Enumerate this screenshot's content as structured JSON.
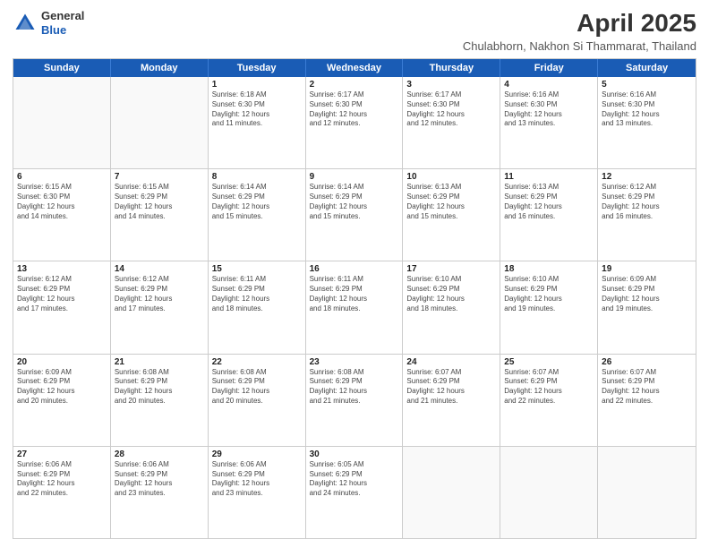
{
  "header": {
    "logo_general": "General",
    "logo_blue": "Blue",
    "month_year": "April 2025",
    "location": "Chulabhorn, Nakhon Si Thammarat, Thailand"
  },
  "weekdays": [
    "Sunday",
    "Monday",
    "Tuesday",
    "Wednesday",
    "Thursday",
    "Friday",
    "Saturday"
  ],
  "rows": [
    [
      {
        "day": "",
        "info": ""
      },
      {
        "day": "",
        "info": ""
      },
      {
        "day": "1",
        "info": "Sunrise: 6:18 AM\nSunset: 6:30 PM\nDaylight: 12 hours\nand 11 minutes."
      },
      {
        "day": "2",
        "info": "Sunrise: 6:17 AM\nSunset: 6:30 PM\nDaylight: 12 hours\nand 12 minutes."
      },
      {
        "day": "3",
        "info": "Sunrise: 6:17 AM\nSunset: 6:30 PM\nDaylight: 12 hours\nand 12 minutes."
      },
      {
        "day": "4",
        "info": "Sunrise: 6:16 AM\nSunset: 6:30 PM\nDaylight: 12 hours\nand 13 minutes."
      },
      {
        "day": "5",
        "info": "Sunrise: 6:16 AM\nSunset: 6:30 PM\nDaylight: 12 hours\nand 13 minutes."
      }
    ],
    [
      {
        "day": "6",
        "info": "Sunrise: 6:15 AM\nSunset: 6:30 PM\nDaylight: 12 hours\nand 14 minutes."
      },
      {
        "day": "7",
        "info": "Sunrise: 6:15 AM\nSunset: 6:29 PM\nDaylight: 12 hours\nand 14 minutes."
      },
      {
        "day": "8",
        "info": "Sunrise: 6:14 AM\nSunset: 6:29 PM\nDaylight: 12 hours\nand 15 minutes."
      },
      {
        "day": "9",
        "info": "Sunrise: 6:14 AM\nSunset: 6:29 PM\nDaylight: 12 hours\nand 15 minutes."
      },
      {
        "day": "10",
        "info": "Sunrise: 6:13 AM\nSunset: 6:29 PM\nDaylight: 12 hours\nand 15 minutes."
      },
      {
        "day": "11",
        "info": "Sunrise: 6:13 AM\nSunset: 6:29 PM\nDaylight: 12 hours\nand 16 minutes."
      },
      {
        "day": "12",
        "info": "Sunrise: 6:12 AM\nSunset: 6:29 PM\nDaylight: 12 hours\nand 16 minutes."
      }
    ],
    [
      {
        "day": "13",
        "info": "Sunrise: 6:12 AM\nSunset: 6:29 PM\nDaylight: 12 hours\nand 17 minutes."
      },
      {
        "day": "14",
        "info": "Sunrise: 6:12 AM\nSunset: 6:29 PM\nDaylight: 12 hours\nand 17 minutes."
      },
      {
        "day": "15",
        "info": "Sunrise: 6:11 AM\nSunset: 6:29 PM\nDaylight: 12 hours\nand 18 minutes."
      },
      {
        "day": "16",
        "info": "Sunrise: 6:11 AM\nSunset: 6:29 PM\nDaylight: 12 hours\nand 18 minutes."
      },
      {
        "day": "17",
        "info": "Sunrise: 6:10 AM\nSunset: 6:29 PM\nDaylight: 12 hours\nand 18 minutes."
      },
      {
        "day": "18",
        "info": "Sunrise: 6:10 AM\nSunset: 6:29 PM\nDaylight: 12 hours\nand 19 minutes."
      },
      {
        "day": "19",
        "info": "Sunrise: 6:09 AM\nSunset: 6:29 PM\nDaylight: 12 hours\nand 19 minutes."
      }
    ],
    [
      {
        "day": "20",
        "info": "Sunrise: 6:09 AM\nSunset: 6:29 PM\nDaylight: 12 hours\nand 20 minutes."
      },
      {
        "day": "21",
        "info": "Sunrise: 6:08 AM\nSunset: 6:29 PM\nDaylight: 12 hours\nand 20 minutes."
      },
      {
        "day": "22",
        "info": "Sunrise: 6:08 AM\nSunset: 6:29 PM\nDaylight: 12 hours\nand 20 minutes."
      },
      {
        "day": "23",
        "info": "Sunrise: 6:08 AM\nSunset: 6:29 PM\nDaylight: 12 hours\nand 21 minutes."
      },
      {
        "day": "24",
        "info": "Sunrise: 6:07 AM\nSunset: 6:29 PM\nDaylight: 12 hours\nand 21 minutes."
      },
      {
        "day": "25",
        "info": "Sunrise: 6:07 AM\nSunset: 6:29 PM\nDaylight: 12 hours\nand 22 minutes."
      },
      {
        "day": "26",
        "info": "Sunrise: 6:07 AM\nSunset: 6:29 PM\nDaylight: 12 hours\nand 22 minutes."
      }
    ],
    [
      {
        "day": "27",
        "info": "Sunrise: 6:06 AM\nSunset: 6:29 PM\nDaylight: 12 hours\nand 22 minutes."
      },
      {
        "day": "28",
        "info": "Sunrise: 6:06 AM\nSunset: 6:29 PM\nDaylight: 12 hours\nand 23 minutes."
      },
      {
        "day": "29",
        "info": "Sunrise: 6:06 AM\nSunset: 6:29 PM\nDaylight: 12 hours\nand 23 minutes."
      },
      {
        "day": "30",
        "info": "Sunrise: 6:05 AM\nSunset: 6:29 PM\nDaylight: 12 hours\nand 24 minutes."
      },
      {
        "day": "",
        "info": ""
      },
      {
        "day": "",
        "info": ""
      },
      {
        "day": "",
        "info": ""
      }
    ]
  ]
}
